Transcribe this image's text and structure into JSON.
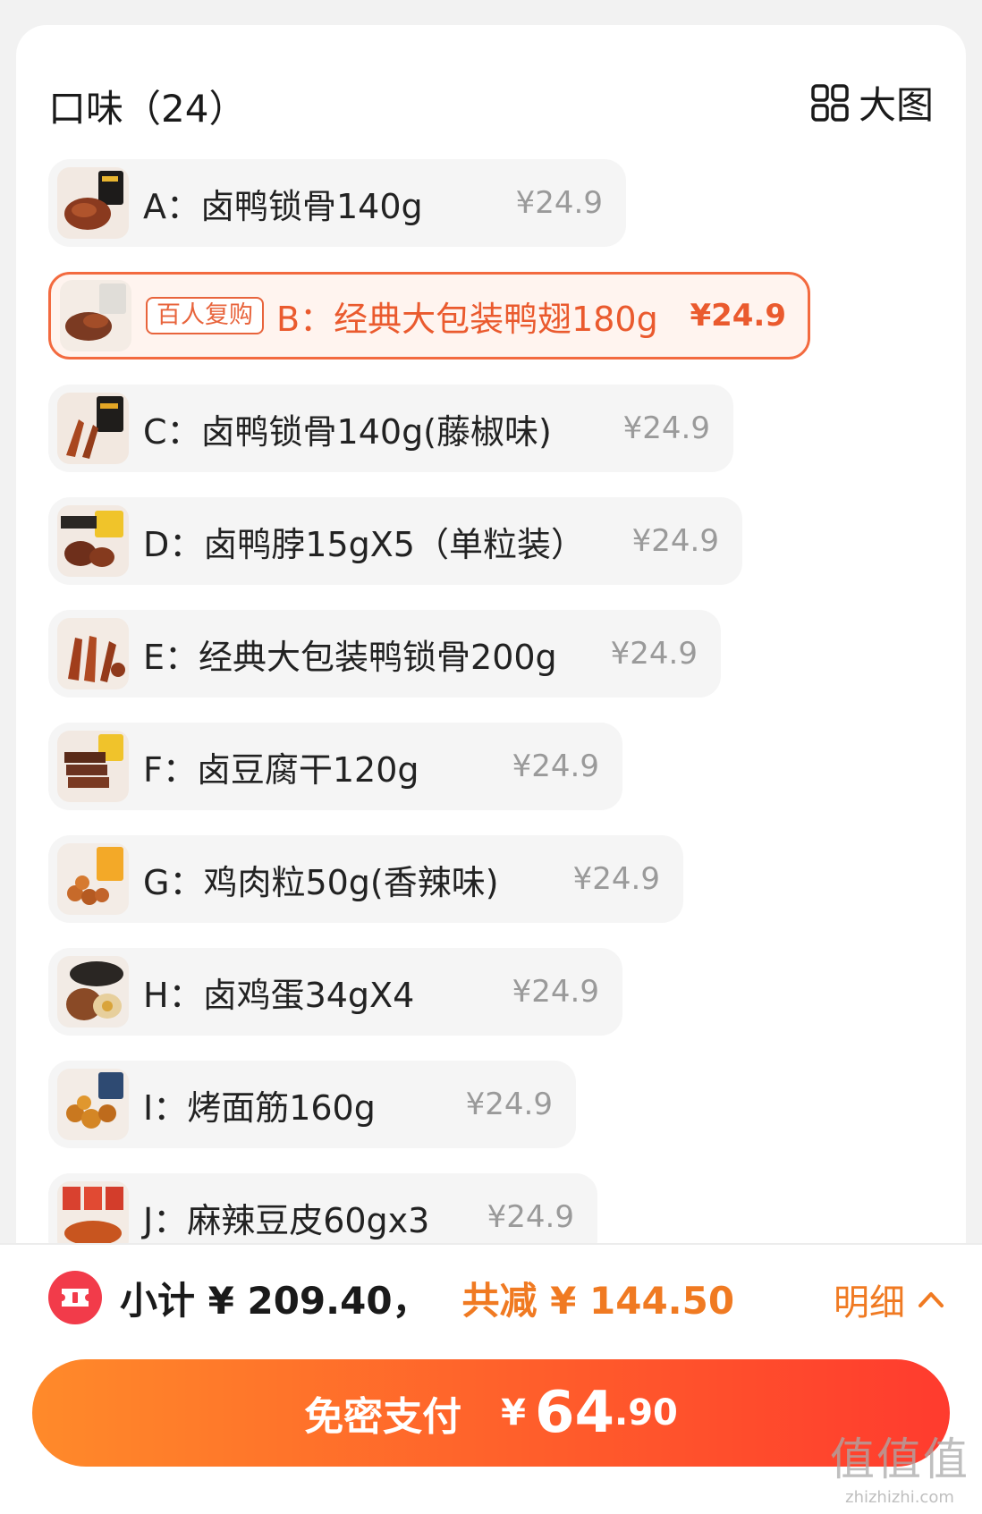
{
  "header": {
    "title": "口味（24）",
    "big_view_label": "大图"
  },
  "options": [
    {
      "label": "A：卤鸭锁骨140g",
      "price": "¥24.9",
      "selected": false,
      "thumb": "thumb-A"
    },
    {
      "badge": "百人复购",
      "label": "B：经典大包装鸭翅180g",
      "price": "¥24.9",
      "selected": true,
      "thumb": "thumb-B"
    },
    {
      "label": "C：卤鸭锁骨140g(藤椒味)",
      "price": "¥24.9",
      "selected": false,
      "thumb": "thumb-C"
    },
    {
      "label": "D：卤鸭脖15gX5（单粒装）",
      "price": "¥24.9",
      "selected": false,
      "thumb": "thumb-D"
    },
    {
      "label": "E：经典大包装鸭锁骨200g",
      "price": "¥24.9",
      "selected": false,
      "thumb": "thumb-E"
    },
    {
      "label": "F：卤豆腐干120g",
      "price": "¥24.9",
      "selected": false,
      "thumb": "thumb-F"
    },
    {
      "label": "G：鸡肉粒50g(香辣味)",
      "price": "¥24.9",
      "selected": false,
      "thumb": "thumb-G"
    },
    {
      "label": "H：卤鸡蛋34gX4",
      "price": "¥24.9",
      "selected": false,
      "thumb": "thumb-H"
    },
    {
      "label": "I：烤面筋160g",
      "price": "¥24.9",
      "selected": false,
      "thumb": "thumb-I"
    },
    {
      "label": "J：麻辣豆皮60gx3",
      "price": "¥24.9",
      "selected": false,
      "thumb": "thumb-J"
    }
  ],
  "footer": {
    "subtotal": "小计 ¥ 209.40，",
    "discount": "共减 ¥ 144.50",
    "detail_label": "明细",
    "pay_label": "免密支付",
    "pay_currency": "¥",
    "pay_amount_int": "64",
    "pay_amount_dec": ".90"
  },
  "watermark": {
    "brand": "值值值",
    "site": "zhizhizhi.com"
  },
  "colors": {
    "accent": "#f07a22",
    "selected_border": "#f36a3f",
    "pay_start": "#ff8a2a",
    "pay_end": "#ff3b2e"
  }
}
